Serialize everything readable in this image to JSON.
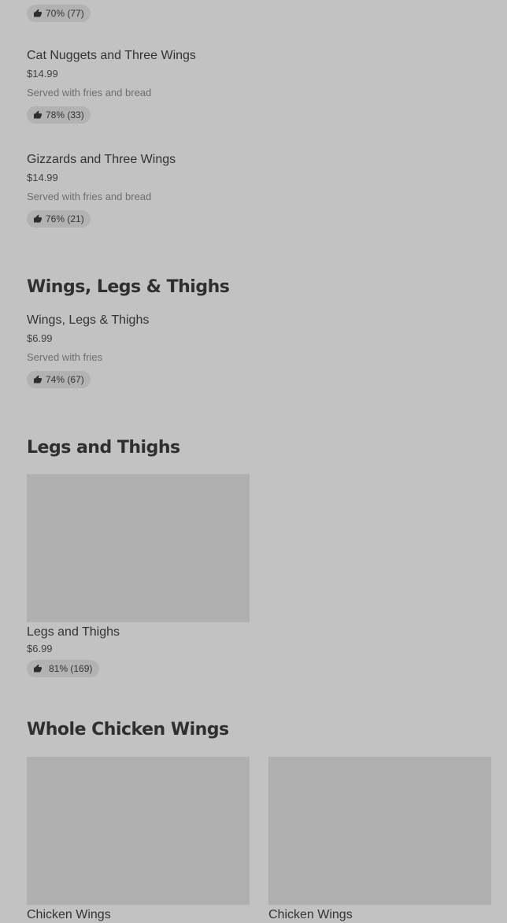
{
  "top_item": {
    "rating": "70% (77)"
  },
  "items": [
    {
      "name": "Cat Nuggets and Three Wings",
      "price": "$14.99",
      "description": "Served with fries and bread",
      "rating": "78% (33)"
    },
    {
      "name": "Gizzards and Three Wings",
      "price": "$14.99",
      "description": "Served with fries and bread",
      "rating": "76% (21)"
    }
  ],
  "sections": {
    "wings_legs_thighs": {
      "title": "Wings, Legs & Thighs",
      "item": {
        "name": "Wings, Legs & Thighs",
        "price": "$6.99",
        "description": "Served with fries",
        "rating": "74% (67)"
      }
    },
    "legs_and_thighs": {
      "title": "Legs and Thighs",
      "card": {
        "name": "Legs and Thighs",
        "price": "$6.99",
        "rating": "81% (169)"
      }
    },
    "whole_chicken_wings": {
      "title": "Whole Chicken Wings",
      "cards": [
        {
          "name": "Chicken Wings"
        },
        {
          "name": "Chicken Wings"
        }
      ]
    }
  },
  "icons": {
    "rating": "thumbs-up-icon"
  }
}
